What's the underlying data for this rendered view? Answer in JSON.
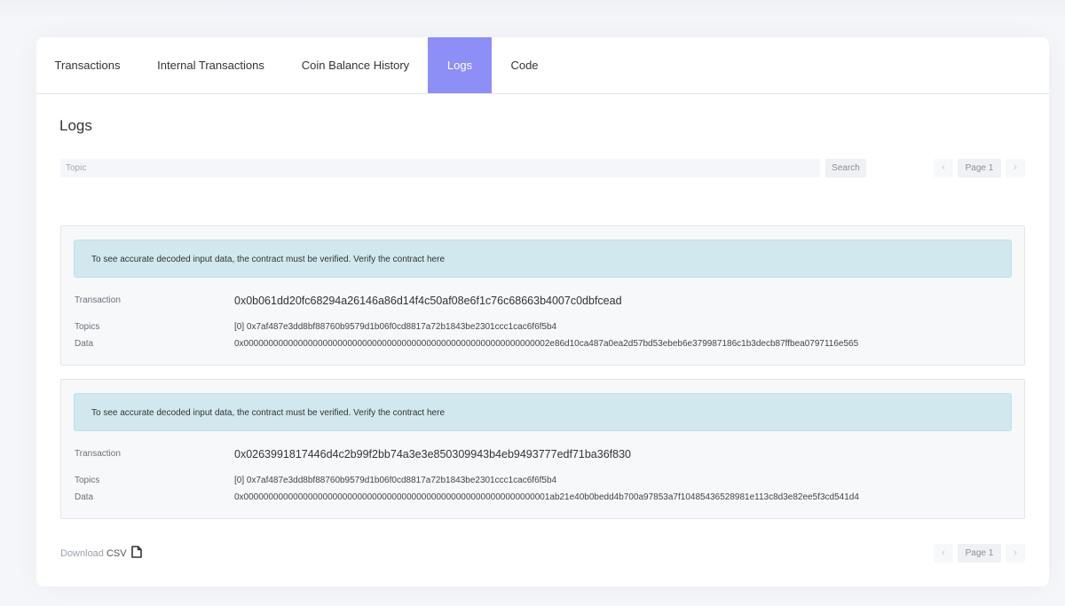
{
  "tabs": [
    {
      "label": "Transactions"
    },
    {
      "label": "Internal Transactions"
    },
    {
      "label": "Coin Balance History"
    },
    {
      "label": "Logs"
    },
    {
      "label": "Code"
    }
  ],
  "section_title": "Logs",
  "search": {
    "placeholder": "Topic",
    "button_label": "Search"
  },
  "pagination": {
    "prev": "‹",
    "page_label": "Page 1",
    "next": "›"
  },
  "logs": [
    {
      "alert": "To see accurate decoded input data, the contract must be verified. Verify the contract here",
      "transaction_label": "Transaction",
      "transaction": "0x0b061dd20fc68294a26146a86d14f4c50af08e6f1c76c68663b4007c0dbfcead",
      "topics_label": "Topics",
      "topics": "[0] 0x7af487e3dd8bf88760b9579d1b06f0cd8817a72b1843be2301ccc1cac6f6f5b4",
      "data_label": "Data",
      "data": "0x00000000000000000000000000000000000000000000000000000000000002e86d10ca487a0ea2d57bd53ebeb6e379987186c1b3decb87ffbea0797116e565"
    },
    {
      "alert": "To see accurate decoded input data, the contract must be verified. Verify the contract here",
      "transaction_label": "Transaction",
      "transaction": "0x0263991817446d4c2b99f2bb74a3e3e850309943b4eb9493777edf71ba36f830",
      "topics_label": "Topics",
      "topics": "[0] 0x7af487e3dd8bf88760b9579d1b06f0cd8817a72b1843be2301ccc1cac6f6f5b4",
      "data_label": "Data",
      "data": "0x00000000000000000000000000000000000000000000000000000000000001ab21e40b0bedd4b700a97853a7f10485436528981e113c8d3e82ee5f3cd541d4"
    }
  ],
  "download": {
    "prefix": "Download",
    "csv": "CSV",
    "icon": "file-icon"
  },
  "colors": {
    "accent": "#8d8ff6",
    "alert_bg": "#d1e8ef",
    "page_bg": "#f5f6fa"
  }
}
